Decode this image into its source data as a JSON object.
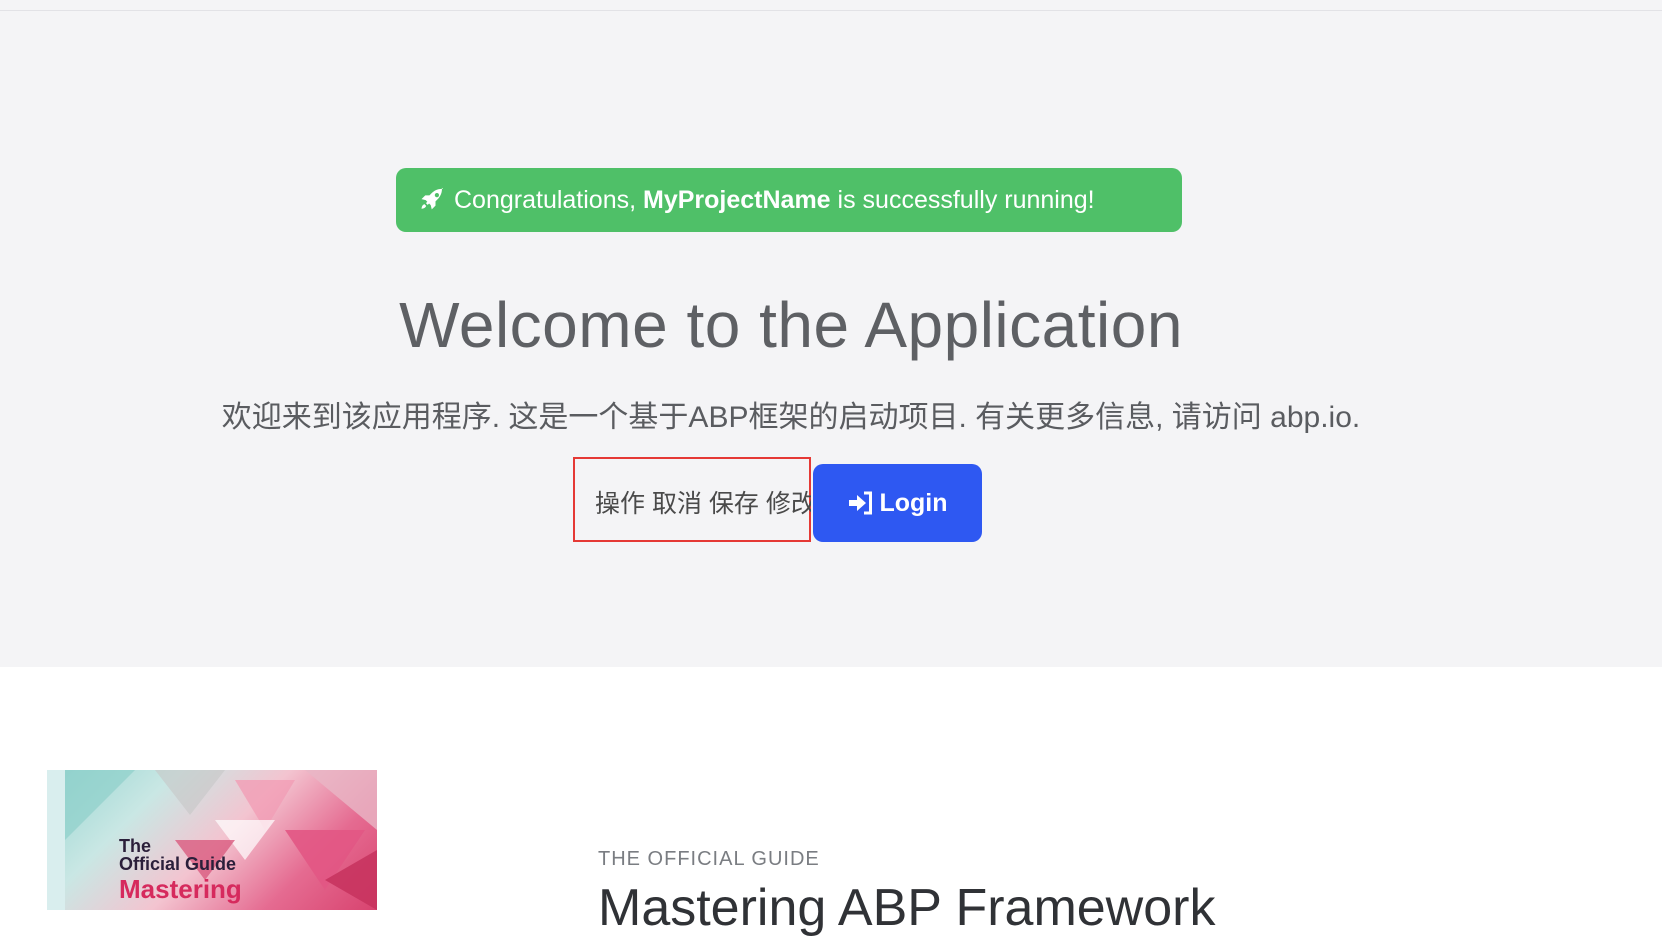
{
  "hero": {
    "alert": {
      "prefix": "Congratulations,",
      "project_name": "MyProjectName",
      "suffix": "is successfully running!",
      "icon": "rocket-icon"
    },
    "title": "Welcome to the Application",
    "subtitle": "欢迎来到该应用程序. 这是一个基于ABP框架的启动项目. 有关更多信息, 请访问 abp.io.",
    "actions_text": "操作 取消 保存 修改",
    "login": {
      "label": "Login",
      "icon": "sign-in-icon"
    }
  },
  "guide": {
    "book": {
      "line1": "The",
      "line2": "Official Guide",
      "line3": "Mastering"
    },
    "eyebrow": "THE OFFICIAL GUIDE",
    "title": "Mastering ABP Framework"
  },
  "colors": {
    "alert_bg": "#4fc068",
    "login_bg": "#2e58f2",
    "hero_bg": "#f4f4f6",
    "highlight_border": "#e53935"
  }
}
